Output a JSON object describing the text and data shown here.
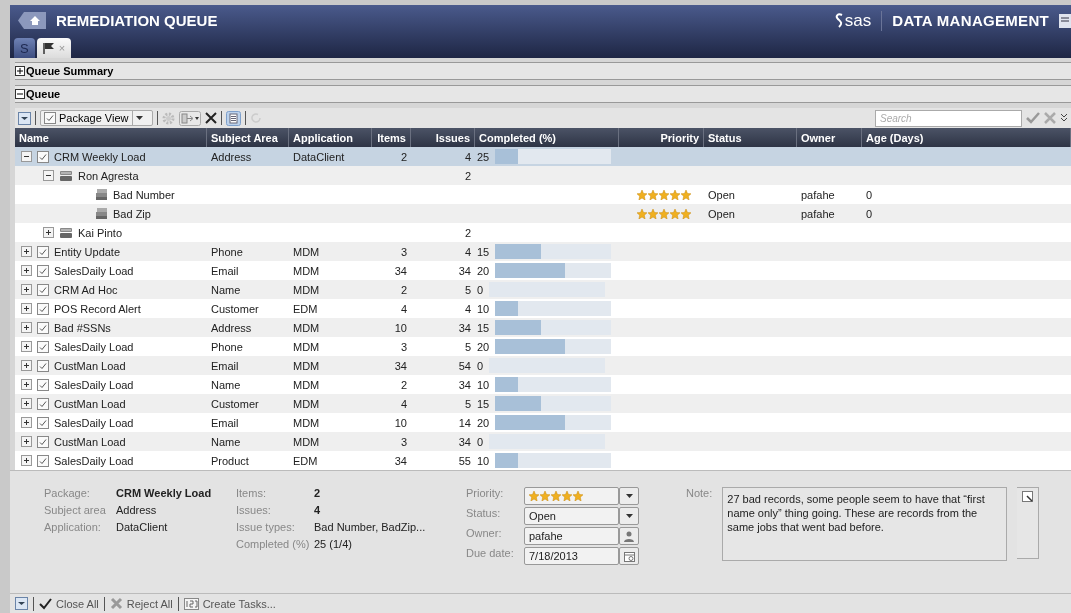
{
  "window": {
    "title": "REMEDIATION QUEUE",
    "brand_logo": "sas",
    "product": "DATA MANAGEMENT"
  },
  "tabs": [
    {
      "kind": "logo",
      "label": "S",
      "selected": false
    },
    {
      "kind": "flag",
      "close": "×",
      "selected": true
    }
  ],
  "sections": [
    {
      "title": "Queue Summary",
      "expanded": false
    },
    {
      "title": "Queue",
      "expanded": true
    }
  ],
  "toolbar": {
    "view": "Package View",
    "search": {
      "placeholder": "Search"
    }
  },
  "table": {
    "columns": [
      "Name",
      "Subject Area",
      "Application",
      "Items",
      "Issues",
      "Completed (%)",
      "Priority",
      "Status",
      "Owner",
      "Age (Days)"
    ],
    "rows": [
      {
        "kind": "package",
        "name": "CRM Weekly Load",
        "subject_area": "Address",
        "application": "DataClient",
        "items": "2",
        "issues": "4",
        "completed": "25",
        "level": 0.2,
        "expanded": true,
        "selected": true,
        "children": [
          {
            "kind": "person",
            "name": "Ron Agresta",
            "issues": "2",
            "expanded": true,
            "selected": false,
            "children": [
              {
                "kind": "issue",
                "name": "Bad Number",
                "stars": 5,
                "status": "Open",
                "owner": "pafahe",
                "age": "0",
                "selected": false
              },
              {
                "kind": "issue",
                "name": "Bad Zip",
                "stars": 5,
                "status": "Open",
                "owner": "pafahe",
                "age": "0",
                "selected": false
              }
            ]
          },
          {
            "kind": "person",
            "name": "Kai Pinto",
            "issues": "2",
            "expanded": false,
            "selected": false
          }
        ]
      },
      {
        "kind": "package",
        "name": "Entity Update",
        "subject_area": "Phone",
        "application": "MDM",
        "items": "3",
        "issues": "4",
        "completed": "15",
        "level": 0.4,
        "expanded": false,
        "selected": false
      },
      {
        "kind": "package",
        "name": "SalesDaily Load",
        "subject_area": "Email",
        "application": "MDM",
        "items": "34",
        "issues": "34",
        "completed": "20",
        "level": 0.6,
        "expanded": false,
        "selected": false
      },
      {
        "kind": "package",
        "name": "CRM Ad Hoc",
        "subject_area": "Name",
        "application": "MDM",
        "items": "2",
        "issues": "5",
        "completed": "0",
        "level": 0,
        "expanded": false,
        "selected": false
      },
      {
        "kind": "package",
        "name": "POS Record Alert",
        "subject_area": "Customer",
        "application": "EDM",
        "items": "4",
        "issues": "4",
        "completed": "10",
        "level": 0.2,
        "expanded": false,
        "selected": false
      },
      {
        "kind": "package",
        "name": "Bad #SSNs",
        "subject_area": "Address",
        "application": "MDM",
        "items": "10",
        "issues": "34",
        "completed": "15",
        "level": 0.4,
        "expanded": false,
        "selected": false
      },
      {
        "kind": "package",
        "name": "SalesDaily Load",
        "subject_area": "Phone",
        "application": "MDM",
        "items": "3",
        "issues": "5",
        "completed": "20",
        "level": 0.6,
        "expanded": false,
        "selected": false
      },
      {
        "kind": "package",
        "name": "CustMan Load",
        "subject_area": "Email",
        "application": "MDM",
        "items": "34",
        "issues": "54",
        "completed": "0",
        "level": 0,
        "expanded": false,
        "selected": false
      },
      {
        "kind": "package",
        "name": "SalesDaily Load",
        "subject_area": "Name",
        "application": "MDM",
        "items": "2",
        "issues": "34",
        "completed": "10",
        "level": 0.2,
        "expanded": false,
        "selected": false
      },
      {
        "kind": "package",
        "name": "CustMan Load",
        "subject_area": "Customer",
        "application": "MDM",
        "items": "4",
        "issues": "5",
        "completed": "15",
        "level": 0.4,
        "expanded": false,
        "selected": false
      },
      {
        "kind": "package",
        "name": "SalesDaily Load",
        "subject_area": "Email",
        "application": "MDM",
        "items": "10",
        "issues": "14",
        "completed": "20",
        "level": 0.6,
        "expanded": false,
        "selected": false
      },
      {
        "kind": "package",
        "name": "CustMan Load",
        "subject_area": "Name",
        "application": "MDM",
        "items": "3",
        "issues": "34",
        "completed": "0",
        "level": 0,
        "expanded": false,
        "selected": false
      },
      {
        "kind": "package",
        "name": "SalesDaily Load",
        "subject_area": "Product",
        "application": "EDM",
        "items": "34",
        "issues": "55",
        "completed": "10",
        "level": 0.2,
        "expanded": false,
        "selected": false
      }
    ]
  },
  "details": {
    "left": [
      {
        "label": "Package:",
        "value": "CRM Weekly Load",
        "bold": true
      },
      {
        "label": "Subject area",
        "value": "Address",
        "bold": false
      },
      {
        "label": "Application:",
        "value": "DataClient",
        "bold": false
      }
    ],
    "middle": [
      {
        "label": "Items:",
        "value": "2",
        "bold": true
      },
      {
        "label": "Issues:",
        "value": "4",
        "bold": true
      },
      {
        "label": "Issue types:",
        "value": "Bad Number, BadZip...",
        "bold": false
      },
      {
        "label": "Completed (%)",
        "value": "25 (1/4)",
        "bold": false
      }
    ],
    "priority": {
      "label": "Priority:",
      "stars": 5
    },
    "status": {
      "label": "Status:",
      "value": "Open"
    },
    "owner": {
      "label": "Owner:",
      "value": "pafahe"
    },
    "due_date": {
      "label": "Due date:",
      "value": "7/18/2013"
    },
    "note": {
      "label": "Note:",
      "text": "27 bad records, some people seem to have that “first name only” thing going. These are records from the same jobs that went bad before."
    }
  },
  "actions": [
    {
      "kind": "close",
      "label": "Close All"
    },
    {
      "kind": "reject",
      "label": "Reject All"
    },
    {
      "kind": "tasks",
      "label": "Create Tasks..."
    }
  ]
}
